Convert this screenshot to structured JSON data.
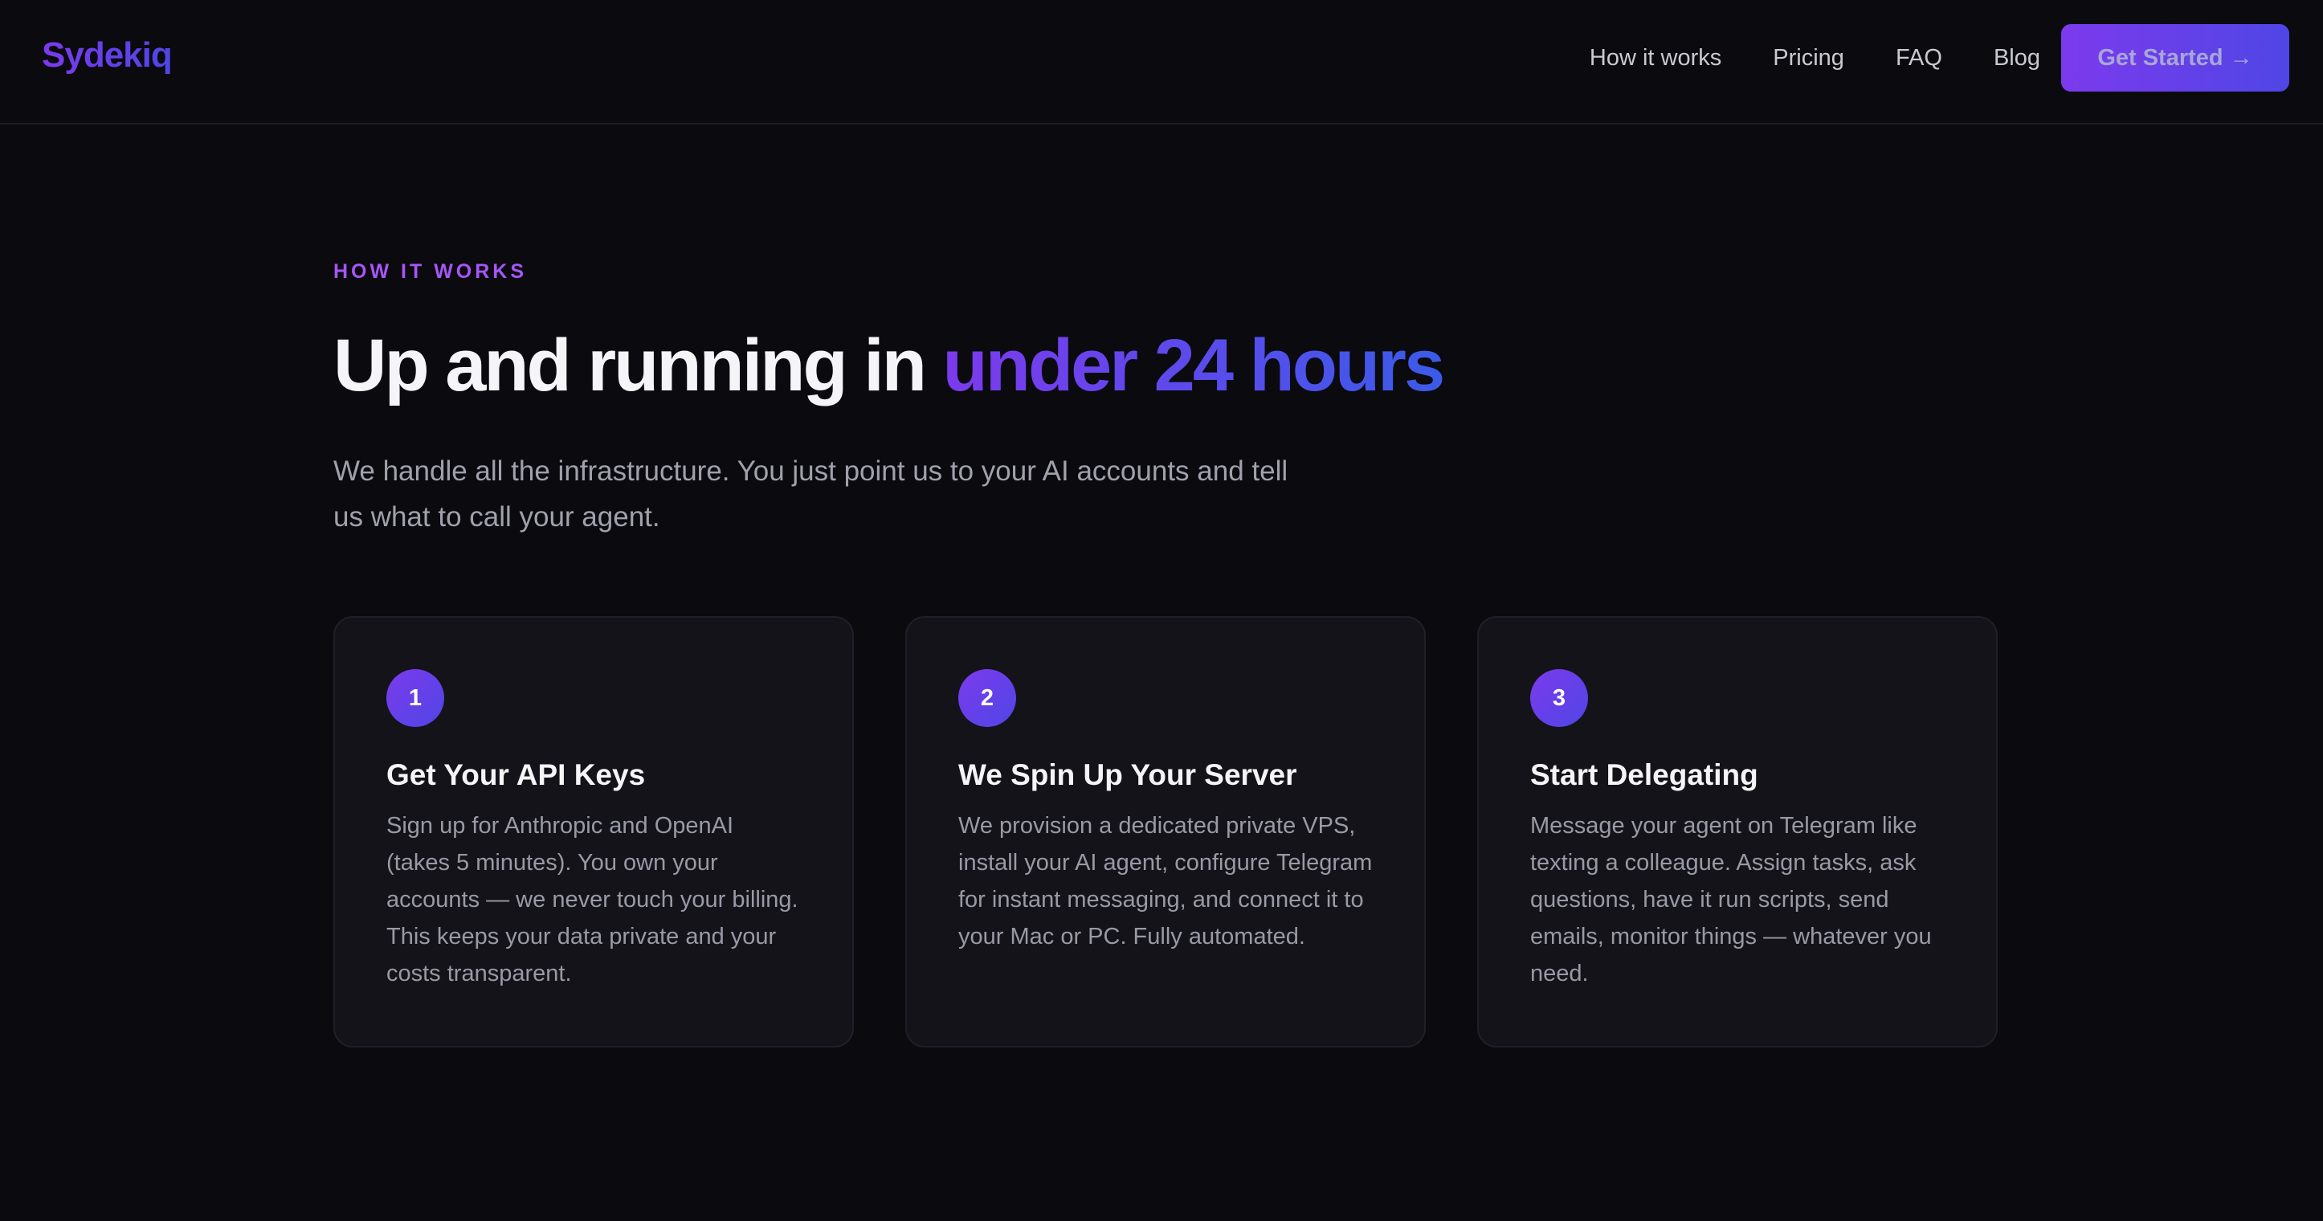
{
  "brand": {
    "name": "Sydekiq"
  },
  "nav": {
    "links": [
      "How it works",
      "Pricing",
      "FAQ",
      "Blog"
    ],
    "cta_label": "Get Started →"
  },
  "section": {
    "eyebrow": "HOW IT WORKS",
    "headline_main": "Up and running in ",
    "headline_accent": "under 24 hours",
    "subtitle": "We handle all the infrastructure. You just point us to your AI accounts and tell us what to call your agent.",
    "steps": [
      {
        "number": "1",
        "title": "Get Your API Keys",
        "body": "Sign up for Anthropic and OpenAI (takes 5 minutes). You own your accounts — we never touch your billing. This keeps your data private and your costs transparent."
      },
      {
        "number": "2",
        "title": "We Spin Up Your Server",
        "body": "We provision a dedicated private VPS, install your AI agent, configure Telegram for instant messaging, and connect it to your Mac or PC. Fully automated."
      },
      {
        "number": "3",
        "title": "Start Delegating",
        "body": "Message your agent on Telegram like texting a colleague. Assign tasks, ask questions, have it run scripts, send emails, monitor things — whatever you need."
      }
    ]
  },
  "colors": {
    "background": "#0a0a0f",
    "accent_purple": "#7c3aed",
    "accent_indigo": "#4f46e5",
    "eyebrow": "#a855f7",
    "card_bg": "#131319"
  }
}
